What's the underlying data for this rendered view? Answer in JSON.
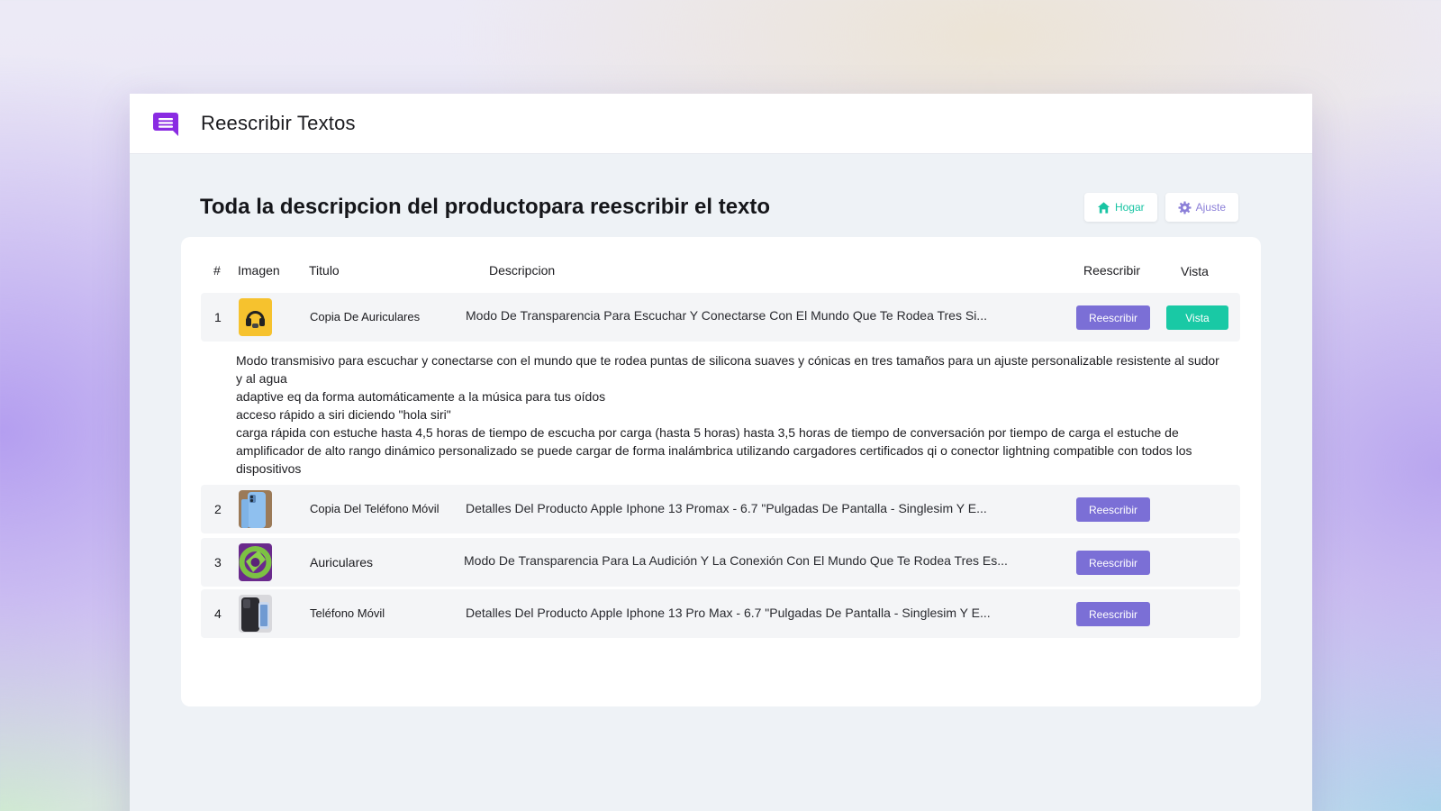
{
  "app": {
    "title": "Reescribir Textos",
    "icon": "chat-bubble-icon"
  },
  "page": {
    "title": "Toda la descripcion del productopara reescribir el texto",
    "actions": [
      {
        "label": "Hogar",
        "icon": "home-icon",
        "color": "#18c4a3"
      },
      {
        "label": "Ajuste",
        "icon": "gear-icon",
        "color": "#8b7fd8"
      }
    ]
  },
  "table": {
    "headers": {
      "num": "#",
      "image": "Imagen",
      "title": "Titulo",
      "description": "Descripcion",
      "rewrite": "Reescribir",
      "view": "Vista"
    },
    "rows": [
      {
        "num": "1",
        "image": "headphones-thumbnail",
        "title": "Copia De Auriculares",
        "description": "Modo De Transparencia Para Escuchar Y Conectarse Con El Mundo Que Te Rodea Tres Si...",
        "rewrite_label": "Reescribir",
        "view_label": "Vista"
      },
      {
        "num": "2",
        "image": "blue-phone-thumbnail",
        "title": "Copia Del Teléfono Móvil",
        "description": "Detalles Del Producto Apple Iphone 13 Promax - 6.7 \"Pulgadas De Pantalla - Singlesim Y E...",
        "rewrite_label": "Reescribir"
      },
      {
        "num": "3",
        "image": "green-headphones-thumbnail",
        "title": "Auriculares",
        "description": "Modo De Transparencia Para La Audición Y La Conexión Con El Mundo Que Te Rodea Tres Es...",
        "rewrite_label": "Reescribir"
      },
      {
        "num": "4",
        "image": "black-phone-thumbnail",
        "title": "Teléfono Móvil",
        "description": "Detalles Del Producto Apple Iphone 13 Pro Max - 6.7 \"Pulgadas De Pantalla - Singlesim Y E...",
        "rewrite_label": "Reescribir"
      }
    ],
    "expanded_text": [
      "Modo transmisivo para escuchar y conectarse con el mundo que te rodea puntas de silicona suaves y cónicas en tres tamaños para un ajuste personalizable resistente al sudor y al agua",
      "adaptive eq da forma automáticamente a la música para tus oídos",
      "acceso rápido a siri diciendo \"hola siri\"",
      "carga rápida con estuche hasta 4,5 horas de tiempo de escucha por carga (hasta 5 horas) hasta 3,5 horas de tiempo de conversación por tiempo de carga el estuche de amplificador de alto rango dinámico personalizado se puede cargar de forma inalámbrica utilizando cargadores certificados qi o conector lightning compatible con todos los dispositivos"
    ]
  },
  "colors": {
    "accent": "#7b6fd6",
    "view": "#19c9a5",
    "brand": "#8a2be2"
  }
}
